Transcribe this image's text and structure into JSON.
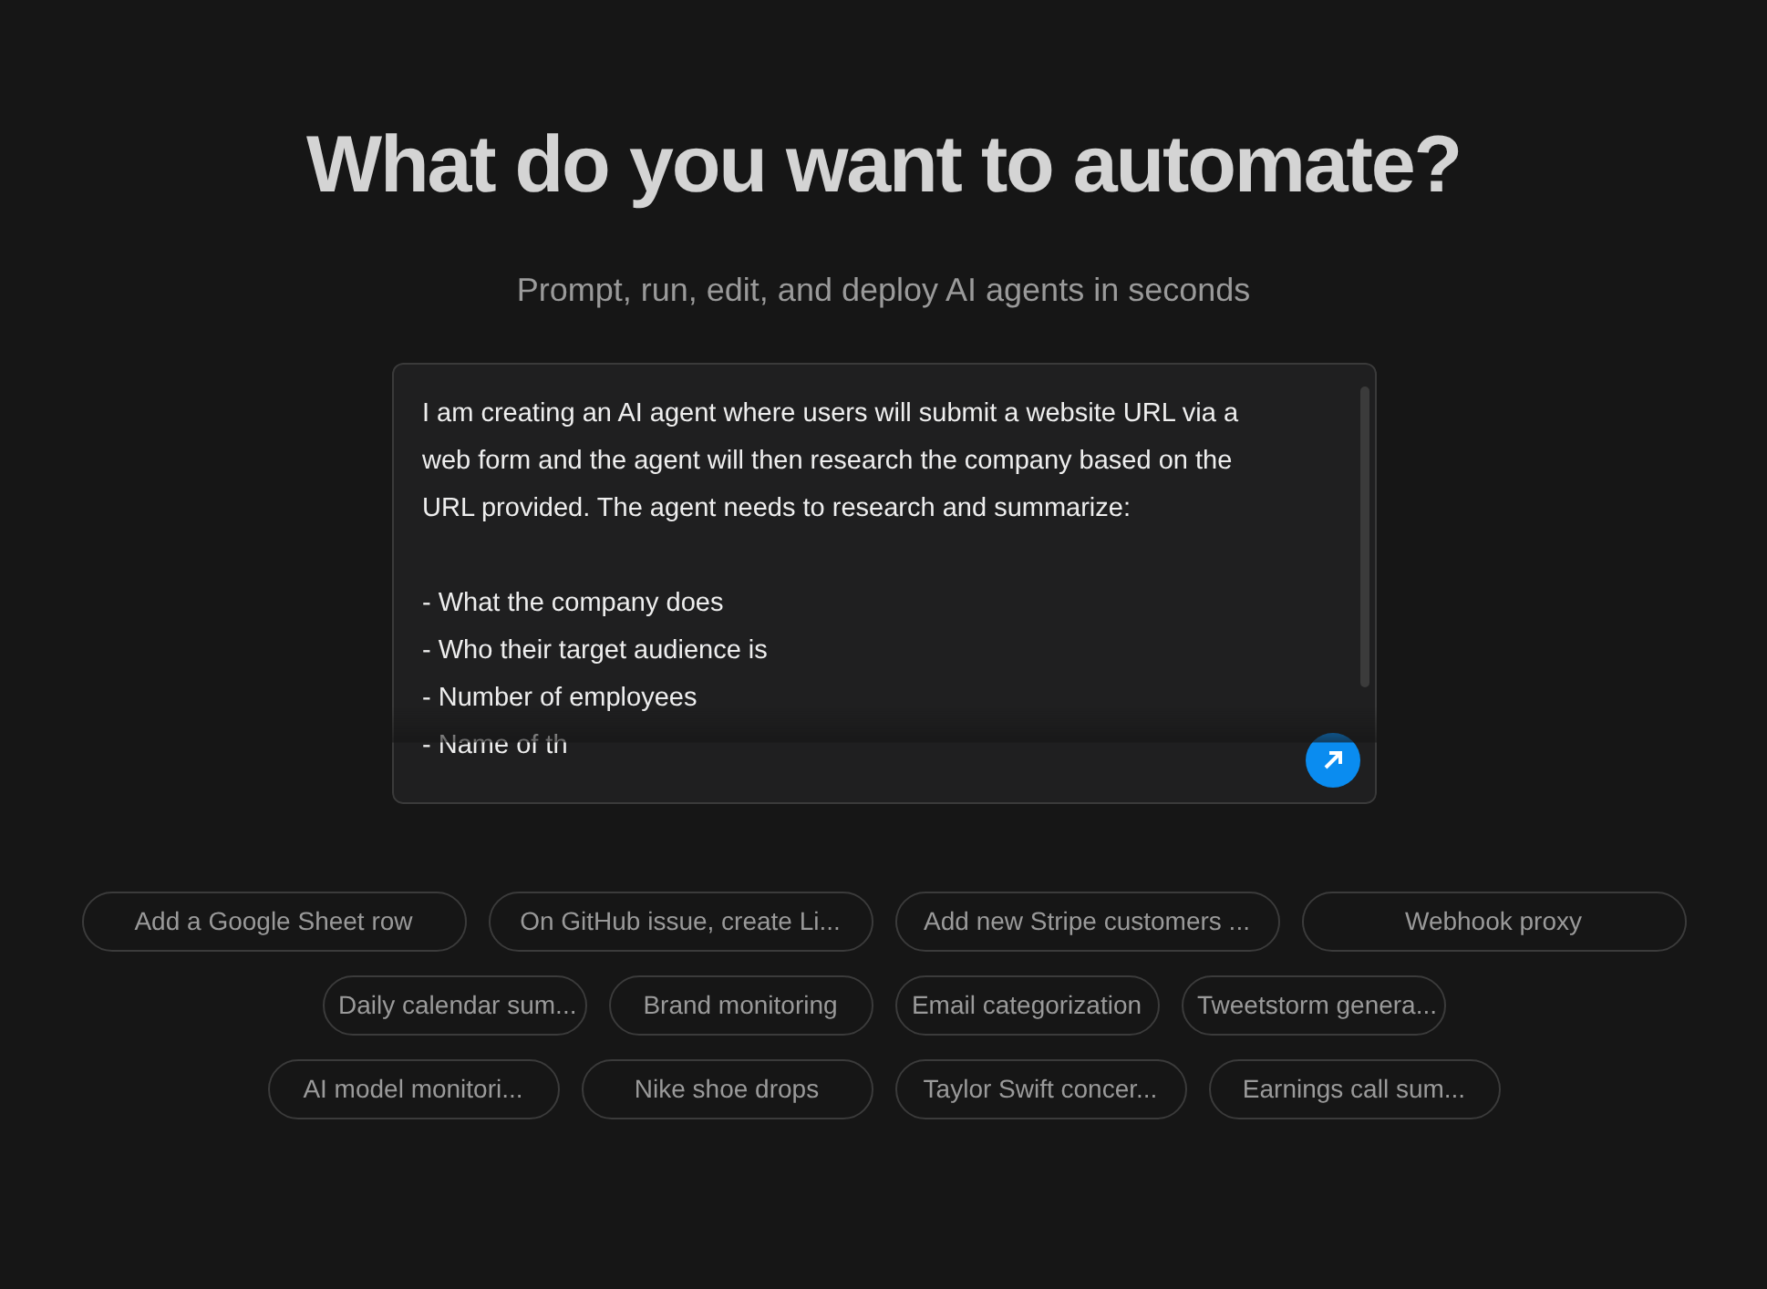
{
  "heading": "What do you want to automate?",
  "subtitle": "Prompt, run, edit, and deploy AI agents in seconds",
  "prompt": {
    "value": "I am creating an AI agent where users will submit a website URL via a\nweb form and the agent will then research the company based on the\nURL provided. The agent needs to research and summarize:\n\n- What the company does\n- Who their target audience is\n- Number of employees\n- Name of th"
  },
  "suggestions": [
    [
      "Add a Google Sheet row",
      "On GitHub issue, create Li...",
      "Add new Stripe customers ...",
      "Webhook proxy"
    ],
    [
      "Daily calendar sum...",
      "Brand monitoring",
      "Email categorization",
      "Tweetstorm genera..."
    ],
    [
      "AI model monitori...",
      "Nike shoe drops",
      "Taylor Swift concer...",
      "Earnings call sum..."
    ]
  ]
}
